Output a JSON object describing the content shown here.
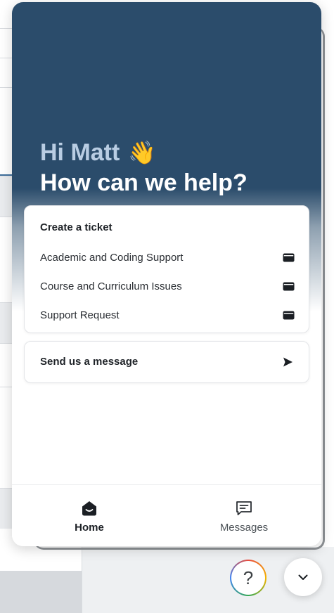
{
  "widget": {
    "greeting": "Hi Matt",
    "greeting_emoji": "👋",
    "subtitle": "How can we help?",
    "colors": {
      "hero": "#2b4c6b",
      "greeting_name": "#b9cde3"
    }
  },
  "ticket_card": {
    "title": "Create a ticket",
    "items": [
      {
        "label": "Academic and Coding Support",
        "icon": "ticket-icon"
      },
      {
        "label": "Course and Curriculum Issues",
        "icon": "ticket-icon"
      },
      {
        "label": "Support Request",
        "icon": "ticket-icon"
      }
    ]
  },
  "message_card": {
    "label": "Send us a message",
    "icon": "send-icon"
  },
  "bottom_nav": {
    "tabs": [
      {
        "label": "Home",
        "icon": "home-icon",
        "active": true
      },
      {
        "label": "Messages",
        "icon": "messages-icon",
        "active": false
      }
    ]
  },
  "floating": {
    "help_symbol": "?",
    "launcher_icon": "chevron-down-icon"
  }
}
